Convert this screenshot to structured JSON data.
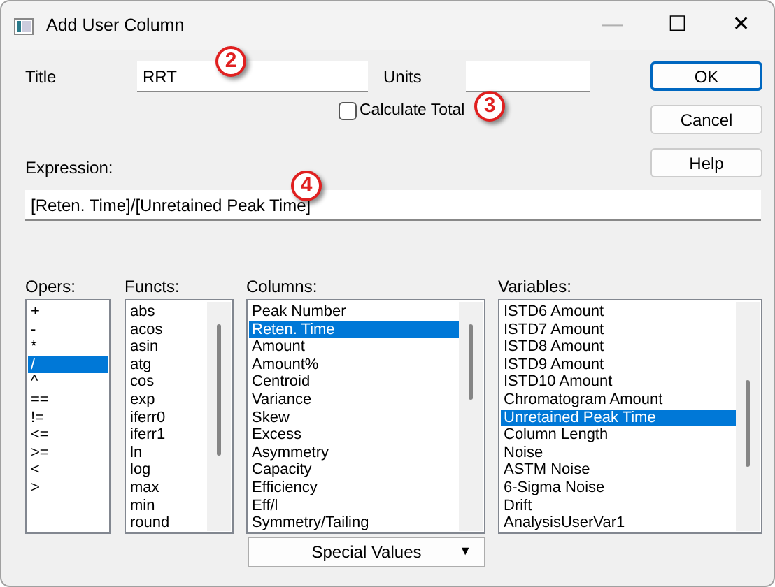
{
  "window": {
    "title": "Add User Column",
    "controls": [
      "—",
      "☐",
      "✕"
    ]
  },
  "title_field": {
    "label": "Title",
    "value": "RRT"
  },
  "units_field": {
    "label": "Units"
  },
  "calculate_total": {
    "label": "Calculate Total",
    "checked": false
  },
  "buttons": [
    {
      "label": "OK",
      "default": true
    },
    {
      "label": "Cancel",
      "default": false
    },
    {
      "label": "Help",
      "default": false
    }
  ],
  "expression": {
    "label": "Expression:",
    "value": "[Reten. Time]/[Unretained Peak Time]"
  },
  "lists": [
    {
      "label": "Opers:",
      "scrollbar": false,
      "items": [
        {
          "text": "+",
          "selected": false
        },
        {
          "text": "-",
          "selected": false
        },
        {
          "text": "*",
          "selected": false
        },
        {
          "text": "/",
          "selected": true
        },
        {
          "text": "^",
          "selected": false
        },
        {
          "text": "==",
          "selected": false
        },
        {
          "text": "!=",
          "selected": false
        },
        {
          "text": "<=",
          "selected": false
        },
        {
          "text": ">=",
          "selected": false
        },
        {
          "text": "<",
          "selected": false
        },
        {
          "text": ">",
          "selected": false
        }
      ]
    },
    {
      "label": "Functs:",
      "scrollbar": true,
      "items": [
        {
          "text": "abs",
          "selected": false
        },
        {
          "text": "acos",
          "selected": false
        },
        {
          "text": "asin",
          "selected": false
        },
        {
          "text": "atg",
          "selected": false
        },
        {
          "text": "cos",
          "selected": false
        },
        {
          "text": "exp",
          "selected": false
        },
        {
          "text": "iferr0",
          "selected": false
        },
        {
          "text": "iferr1",
          "selected": false
        },
        {
          "text": "ln",
          "selected": false
        },
        {
          "text": "log",
          "selected": false
        },
        {
          "text": "max",
          "selected": false
        },
        {
          "text": "min",
          "selected": false
        },
        {
          "text": "round",
          "selected": false
        }
      ]
    },
    {
      "label": "Columns:",
      "scrollbar": true,
      "items": [
        {
          "text": "Peak Number",
          "selected": false
        },
        {
          "text": "Reten. Time",
          "selected": true
        },
        {
          "text": "Amount",
          "selected": false
        },
        {
          "text": "Amount%",
          "selected": false
        },
        {
          "text": "Centroid",
          "selected": false
        },
        {
          "text": "Variance",
          "selected": false
        },
        {
          "text": "Skew",
          "selected": false
        },
        {
          "text": "Excess",
          "selected": false
        },
        {
          "text": "Asymmetry",
          "selected": false
        },
        {
          "text": "Capacity",
          "selected": false
        },
        {
          "text": "Efficiency",
          "selected": false
        },
        {
          "text": "Eff/l",
          "selected": false
        },
        {
          "text": "Symmetry/Tailing",
          "selected": false
        }
      ]
    },
    {
      "label": "Variables:",
      "scrollbar": true,
      "items": [
        {
          "text": "ISTD6 Amount",
          "selected": false
        },
        {
          "text": "ISTD7 Amount",
          "selected": false
        },
        {
          "text": "ISTD8 Amount",
          "selected": false
        },
        {
          "text": "ISTD9 Amount",
          "selected": false
        },
        {
          "text": "ISTD10 Amount",
          "selected": false
        },
        {
          "text": "Chromatogram Amount",
          "selected": false
        },
        {
          "text": "Unretained Peak Time",
          "selected": true
        },
        {
          "text": "Column Length",
          "selected": false
        },
        {
          "text": "Noise",
          "selected": false
        },
        {
          "text": "ASTM Noise",
          "selected": false
        },
        {
          "text": "6-Sigma Noise",
          "selected": false
        },
        {
          "text": "Drift",
          "selected": false
        },
        {
          "text": "AnalysisUserVar1",
          "selected": false
        }
      ]
    }
  ],
  "special_values": {
    "label": "Special Values",
    "arrow": "▼"
  },
  "callouts": [
    {
      "label": "2"
    },
    {
      "label": "3"
    },
    {
      "label": "4"
    }
  ]
}
